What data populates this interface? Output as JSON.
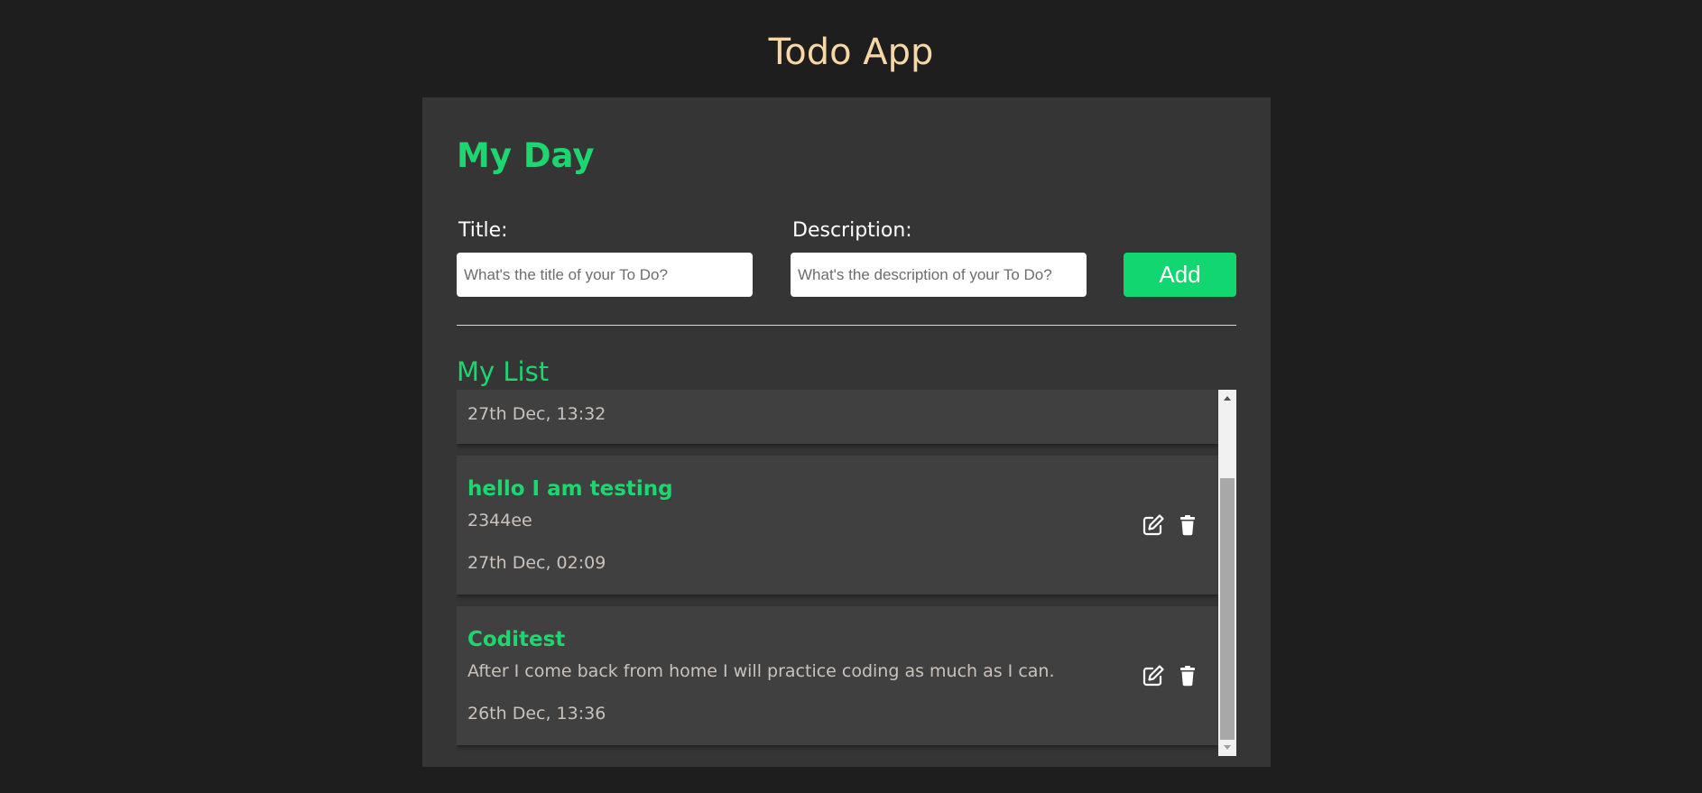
{
  "app": {
    "title": "Todo App"
  },
  "panel": {
    "title": "My Day"
  },
  "form": {
    "title_label": "Title:",
    "title_placeholder": "What's the title of your To Do?",
    "title_value": "",
    "description_label": "Description:",
    "description_placeholder": "What's the description of your To Do?",
    "description_value": "",
    "add_label": "Add"
  },
  "list": {
    "title": "My List",
    "items": [
      {
        "title": "",
        "description": "",
        "date": "27th Dec, 13:32"
      },
      {
        "title": "hello I am testing",
        "description": "2344ee",
        "date": "27th Dec, 02:09"
      },
      {
        "title": "Coditest",
        "description": "After I come back from home I will practice coding as much as I can.",
        "date": "26th Dec, 13:36"
      }
    ]
  },
  "icons": {
    "edit": "edit-icon",
    "delete": "trash-icon"
  },
  "colors": {
    "background": "#1e1e1e",
    "panel": "#353535",
    "card": "#404040",
    "accent": "#1ed66f",
    "app_title": "#f8d7a6",
    "muted_text": "#c9c2bd"
  }
}
